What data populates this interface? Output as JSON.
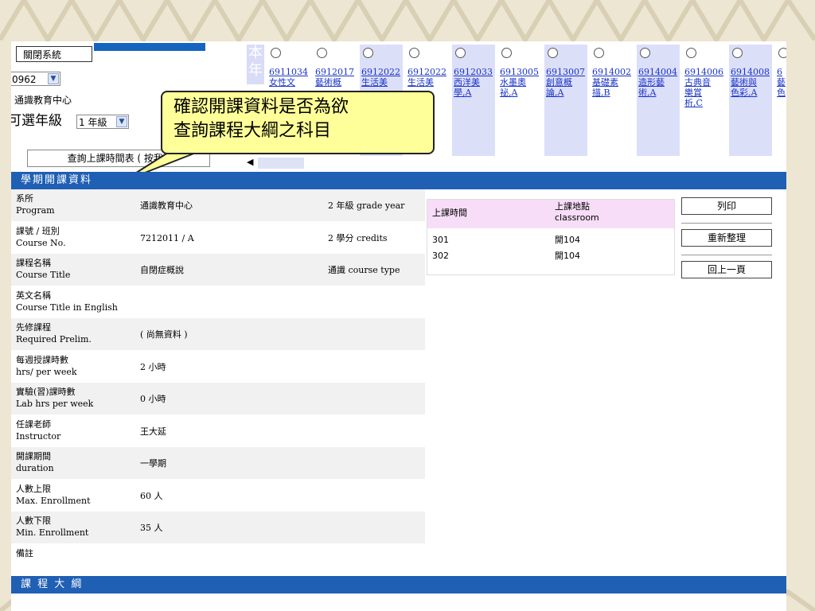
{
  "controls": {
    "close_label": "關閉系統",
    "year_value": "0962",
    "dept_value": "通識教育中心",
    "grade_label": "可選年級",
    "grade_value": "1 年級",
    "query_label": "查詢上課時間表 ( 按我 )"
  },
  "course_strip": {
    "label": "本\n年",
    "courses": [
      {
        "code": "6911034",
        "name": "女性文",
        "shade": false
      },
      {
        "code": "6912017",
        "name": "藝術概",
        "shade": false
      },
      {
        "code": "6912022",
        "name": "生活美",
        "shade": true
      },
      {
        "code": "6912022",
        "name": "生活美",
        "shade": false
      },
      {
        "code": "6912033",
        "name": "西洋美\n學,A",
        "shade": true
      },
      {
        "code": "6913005",
        "name": "水墨奧\n祕,A",
        "shade": false
      },
      {
        "code": "6913007",
        "name": "創意概\n論,A",
        "shade": true
      },
      {
        "code": "6914002",
        "name": "基礎素\n描,B",
        "shade": false
      },
      {
        "code": "6914004",
        "name": "造形藝\n術,A",
        "shade": true
      },
      {
        "code": "6914006",
        "name": "古典音\n樂賞\n析,C",
        "shade": false
      },
      {
        "code": "6914008",
        "name": "藝術與\n色彩,A",
        "shade": true
      },
      {
        "code": "6",
        "name": "藝\n色",
        "shade": false
      }
    ]
  },
  "callout": {
    "text": "確認開課資料是否為欲\n查詢課程大綱之科目"
  },
  "section_header": "學期開課資料",
  "info_rows": [
    {
      "label": "系所\nProgram",
      "value": "通識教育中心",
      "extra": "2 年級 grade year"
    },
    {
      "label": "課號 / 班別\nCourse No.",
      "value": "7212011 / A",
      "extra": "2 學分 credits"
    },
    {
      "label": "課程名稱\nCourse Title",
      "value": "自閉症概說",
      "extra": "通識 course type"
    },
    {
      "label": "英文名稱\nCourse Title in English",
      "value": "",
      "extra": ""
    },
    {
      "label": "先修課程\nRequired Prelim.",
      "value": "( 尚無資料 )",
      "extra": ""
    },
    {
      "label": "每週授課時數\nhrs/ per week",
      "value": "2 小時",
      "extra": ""
    },
    {
      "label": "實驗(習)課時數\nLab hrs per week",
      "value": "0 小時",
      "extra": ""
    },
    {
      "label": "任課老師\nInstructor",
      "value": "王大延",
      "extra": ""
    },
    {
      "label": "開課期間\nduration",
      "value": "一學期",
      "extra": ""
    },
    {
      "label": "人數上限\nMax. Enrollment",
      "value": "60 人",
      "extra": ""
    },
    {
      "label": "人數下限\nMin. Enrollment",
      "value": "35 人",
      "extra": ""
    },
    {
      "label": "備註",
      "value": "",
      "extra": ""
    }
  ],
  "schedule": {
    "header_time": "上課時間",
    "header_place": "上課地點\nclassroom",
    "rows": [
      {
        "time": "301",
        "place": "開104"
      },
      {
        "time": "302",
        "place": "開104"
      }
    ]
  },
  "actions": {
    "print": "列印",
    "refresh": "重新整理",
    "back": "回上一頁"
  },
  "footer_header": "課 程 大 綱",
  "colors": {
    "header_blue": "#1f5fb4",
    "callout_yellow": "#ffff99",
    "schedule_header": "#f7ddf7"
  }
}
